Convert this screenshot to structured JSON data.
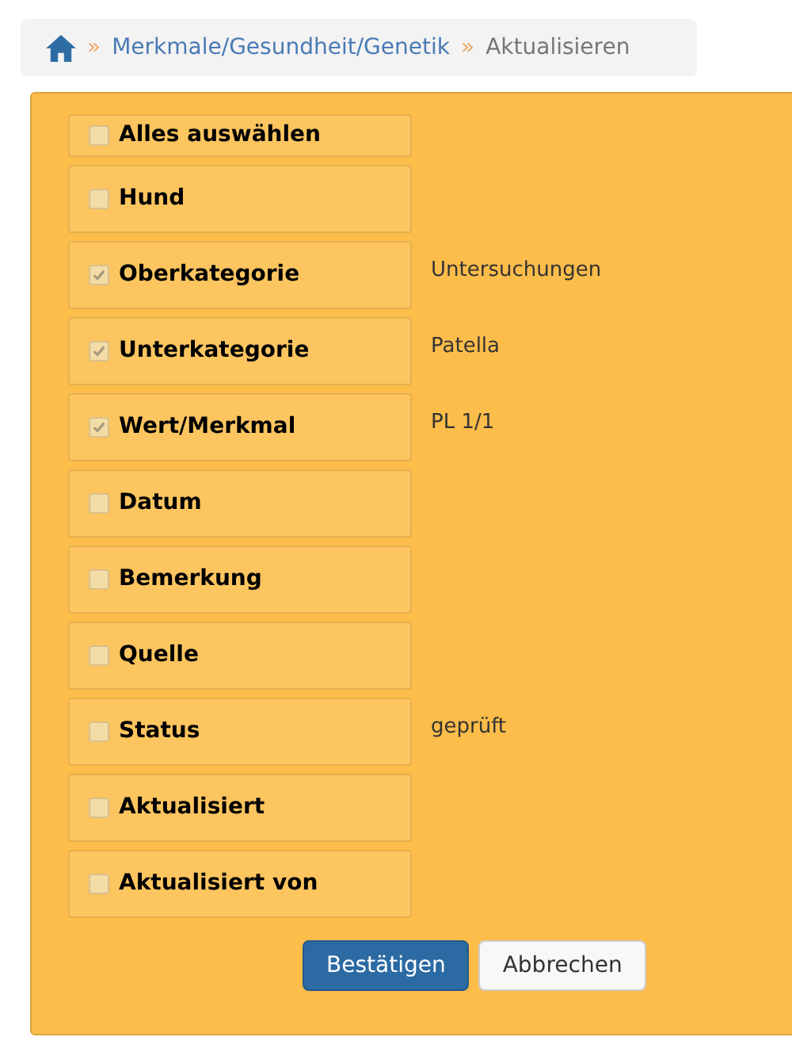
{
  "breadcrumb": {
    "items": [
      {
        "label": "Merkmale/Gesundheit/Genetik",
        "kind": "link"
      },
      {
        "label": "Aktualisieren",
        "kind": "current"
      }
    ],
    "separator": "»"
  },
  "select_all": {
    "label": "Alles auswählen",
    "checked": false
  },
  "fields": [
    {
      "label": "Hund",
      "checked": false
    },
    {
      "label": "Oberkategorie",
      "checked": true,
      "value": "Untersuchungen"
    },
    {
      "label": "Unterkategorie",
      "checked": true,
      "value": "Patella"
    },
    {
      "label": "Wert/Merkmal",
      "checked": true,
      "value": "PL 1/1"
    },
    {
      "label": "Datum",
      "checked": false
    },
    {
      "label": "Bemerkung",
      "checked": false
    },
    {
      "label": "Quelle",
      "checked": false
    },
    {
      "label": "Status",
      "checked": false,
      "value": "geprüft"
    },
    {
      "label": "Aktualisiert",
      "checked": false
    },
    {
      "label": "Aktualisiert von",
      "checked": false
    }
  ],
  "buttons": [
    {
      "label": "Bestätigen",
      "kind": "primary"
    },
    {
      "label": "Abbrechen",
      "kind": "default"
    }
  ]
}
